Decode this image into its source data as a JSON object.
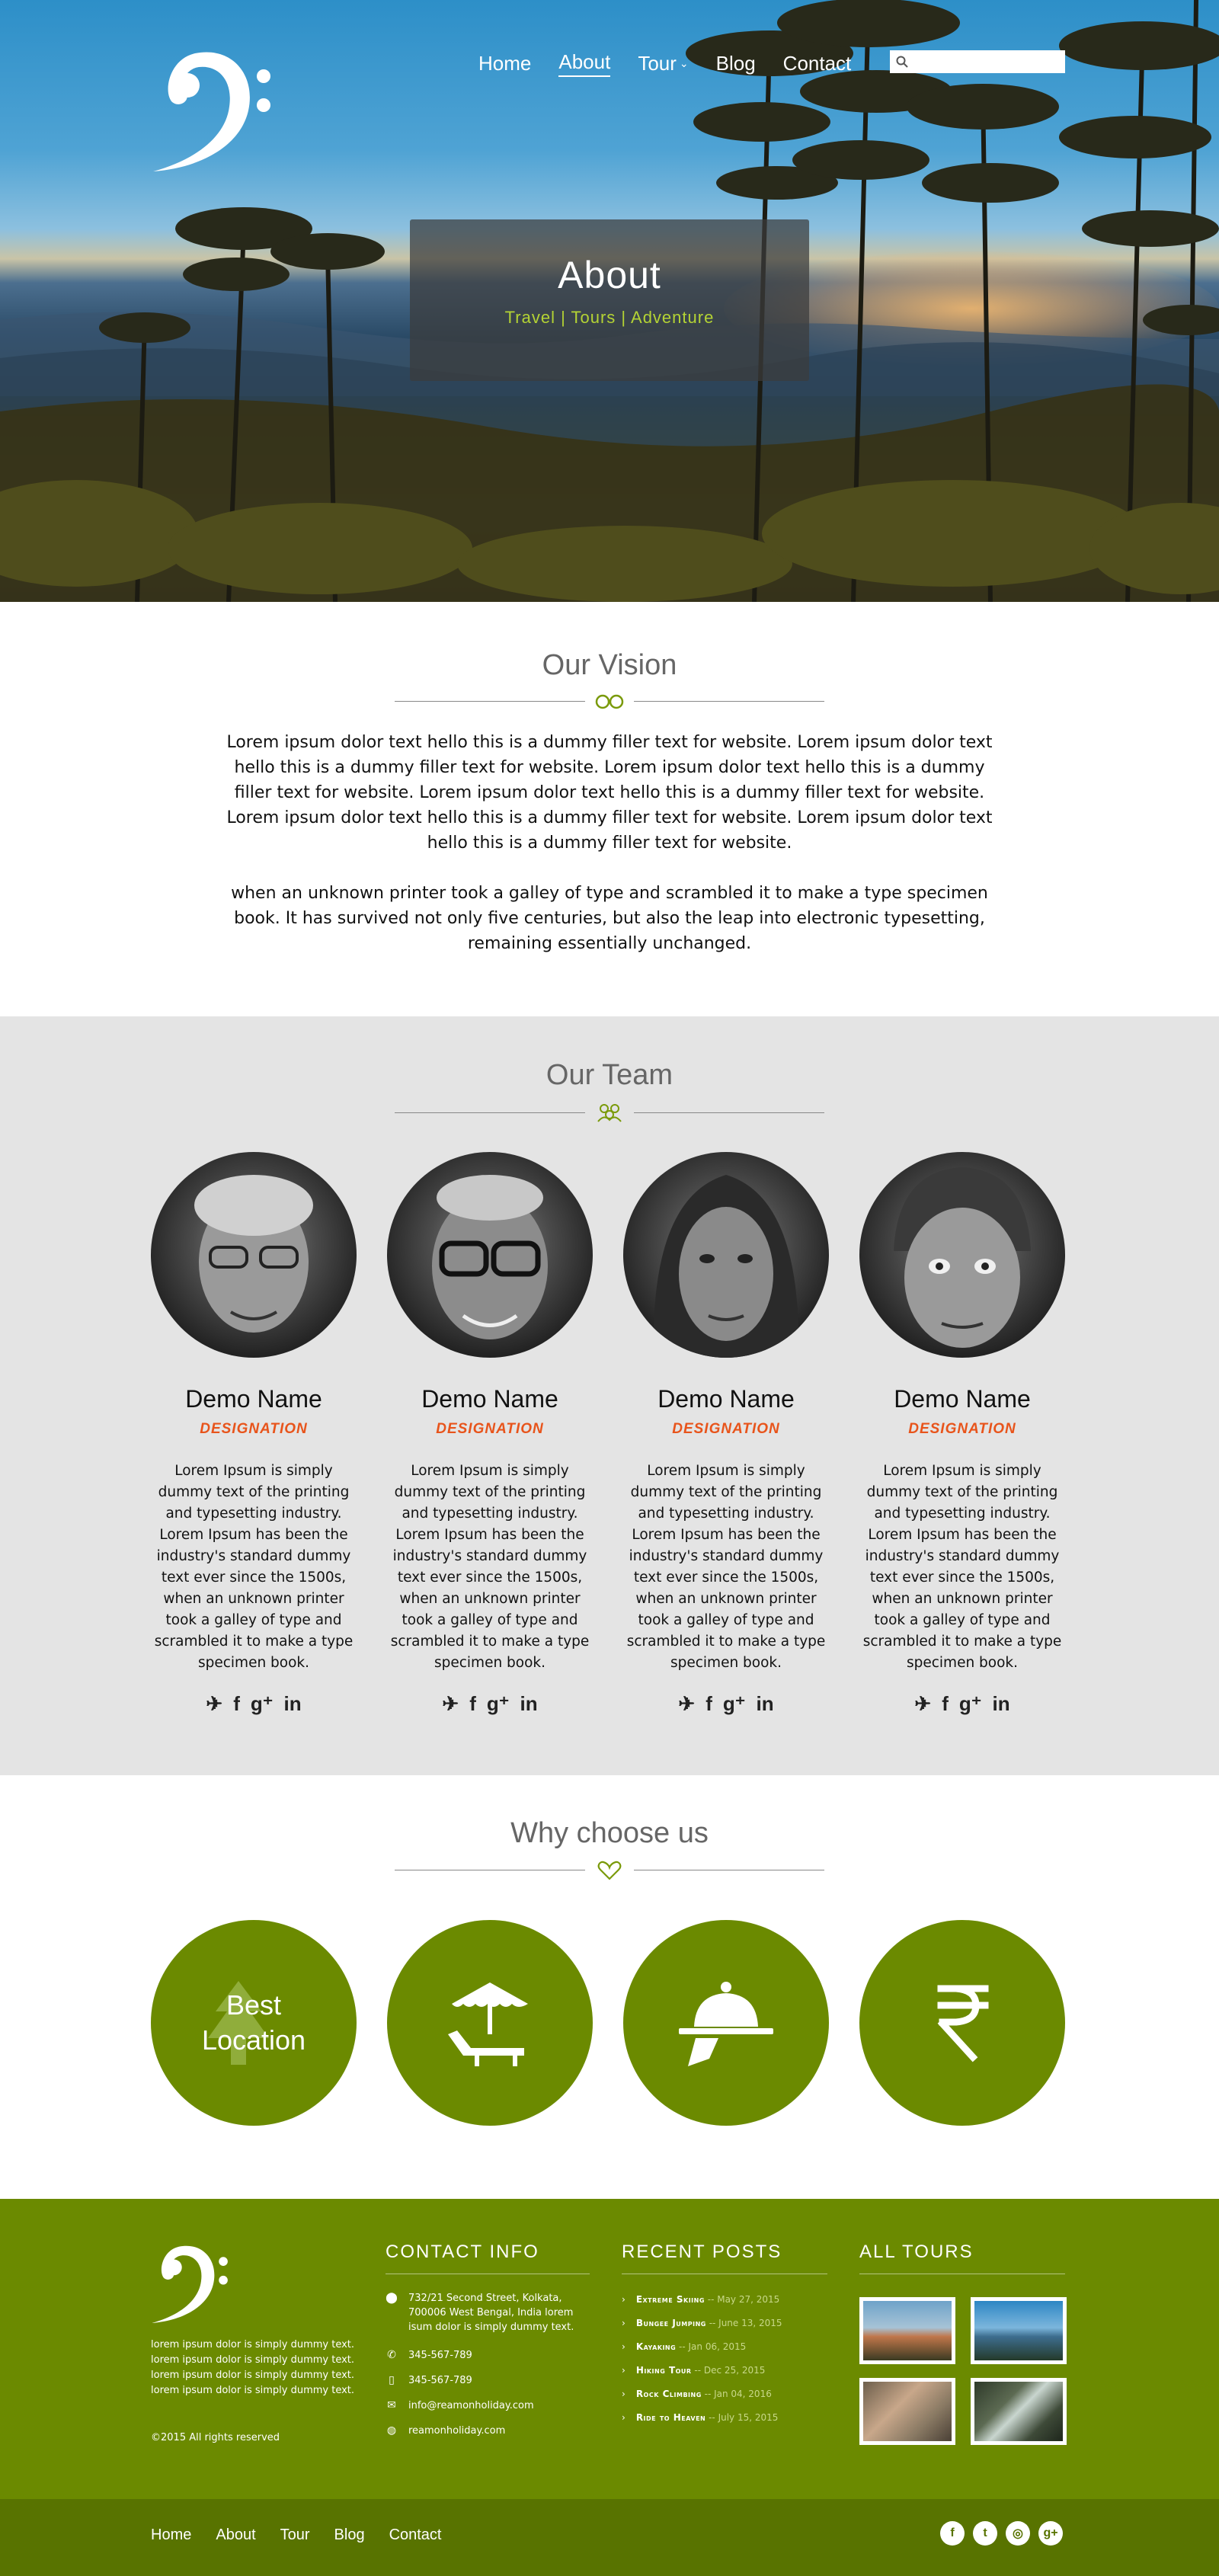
{
  "colors": {
    "accent_green": "#6b8a00",
    "designation_orange": "#e8541b",
    "hero_subtitle_green": "#b4d334",
    "team_bg": "#e4e4e4"
  },
  "header": {
    "logo_icon": "bass-clef-icon",
    "nav": [
      {
        "label": "Home"
      },
      {
        "label": "About"
      },
      {
        "label": "Tour"
      },
      {
        "label": "Blog"
      },
      {
        "label": "Contact"
      }
    ],
    "search": {
      "icon": "search-icon",
      "placeholder": ""
    }
  },
  "hero": {
    "title": "About",
    "subtitle": "Travel | Tours | Adventure"
  },
  "vision": {
    "title": "Our Vision",
    "divider_icon": "glasses-icon",
    "p1": "Lorem ipsum dolor text hello this is a dummy filler text for website. Lorem ipsum dolor text hello this is a dummy filler text for website.  Lorem ipsum dolor text hello this is a dummy filler text for website. Lorem ipsum dolor text hello this is a dummy filler text for website. Lorem ipsum dolor text hello this is a dummy filler text for website. Lorem ipsum dolor text hello this is a dummy filler text for website.",
    "p2": "when an unknown printer took a galley of type and scrambled it to make a type specimen book. It has survived not only five centuries, but also the leap into electronic typesetting, remaining essentially unchanged."
  },
  "team": {
    "title": "Our Team",
    "divider_icon": "people-icon",
    "members": [
      {
        "name": "Demo Name",
        "designation": "DESIGNATION",
        "bio": "Lorem Ipsum is simply dummy text of the printing and typesetting industry. Lorem Ipsum has been the industry's standard dummy text ever since the 1500s, when an unknown printer took a galley of type and scrambled it to make a type specimen book."
      },
      {
        "name": "Demo Name",
        "designation": "DESIGNATION",
        "bio": "Lorem Ipsum is simply dummy text of the printing and typesetting industry. Lorem Ipsum has been the industry's standard dummy text ever since the 1500s, when an unknown printer took a galley of type and scrambled it to make a type specimen book."
      },
      {
        "name": "Demo Name",
        "designation": "DESIGNATION",
        "bio": "Lorem Ipsum is simply dummy text of the printing and typesetting industry. Lorem Ipsum has been the industry's standard dummy text ever since the 1500s, when an unknown printer took a galley of type and scrambled it to make a type specimen book."
      },
      {
        "name": "Demo Name",
        "designation": "DESIGNATION",
        "bio": "Lorem Ipsum is simply dummy text of the printing and typesetting industry. Lorem Ipsum has been the industry's standard dummy text ever since the 1500s, when an unknown printer took a galley of type and scrambled it to make a type specimen book."
      }
    ],
    "social_icons": [
      "twitter-icon",
      "facebook-icon",
      "google-plus-icon",
      "linkedin-icon"
    ]
  },
  "why": {
    "title": "Why choose us",
    "divider_icon": "heart-icon",
    "items": [
      {
        "label": "Best Location",
        "icon": "tree-icon"
      },
      {
        "icon": "beach-lounger-icon"
      },
      {
        "icon": "food-cloche-icon"
      },
      {
        "icon": "rupee-icon"
      }
    ]
  },
  "footer": {
    "logo_icon": "bass-clef-icon",
    "about": "lorem ipsum dolor is simply dummy text. lorem ipsum dolor is simply dummy text. lorem ipsum dolor is simply dummy text. lorem ipsum dolor is simply dummy text.",
    "copyright": "©2015 All rights reserved",
    "contact": {
      "title": "CONTACT INFO",
      "address": "732/21 Second Street, Kolkata, 700006 West Bengal, India lorem isum dolor is simply dummy text.",
      "phone1": "345-567-789",
      "phone2": "345-567-789",
      "email": "info@reamonholiday.com",
      "web": "reamonholiday.com"
    },
    "posts": {
      "title": "RECENT POSTS",
      "items": [
        {
          "title": "Extreme Skiing",
          "date": "-- May 27, 2015"
        },
        {
          "title": "Bungee Jumping",
          "date": "-- June 13, 2015"
        },
        {
          "title": "Kayaking",
          "date": "-- Jan 06, 2015"
        },
        {
          "title": "Hiking Tour",
          "date": "-- Dec 25, 2015"
        },
        {
          "title": "Rock Climbing",
          "date": "-- Jan 04, 2016"
        },
        {
          "title": "Ride to Heaven",
          "date": "-- July 15, 2015"
        }
      ]
    },
    "tours": {
      "title": "ALL TOURS"
    },
    "bottom_nav": [
      {
        "label": "Home"
      },
      {
        "label": "About"
      },
      {
        "label": "Tour"
      },
      {
        "label": "Blog"
      },
      {
        "label": "Contact"
      }
    ],
    "social": [
      "facebook-icon",
      "twitter-icon",
      "instagram-icon",
      "google-plus-icon"
    ]
  }
}
